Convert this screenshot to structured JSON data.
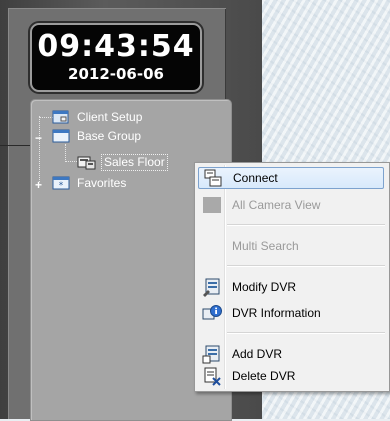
{
  "clock": {
    "time": "09:43:54",
    "date": "2012-06-06"
  },
  "tree": {
    "items": [
      {
        "label": "Client Setup",
        "icon": "client-setup-icon"
      },
      {
        "label": "Base Group",
        "icon": "group-icon",
        "expander": "−"
      },
      {
        "label": "Sales Floor",
        "icon": "dvr-icon",
        "selected": true
      },
      {
        "label": "Favorites",
        "icon": "favorites-icon",
        "expander": "+"
      }
    ]
  },
  "context_menu": {
    "items": [
      {
        "label": "Connect",
        "icon": "connect-icon",
        "state": "hover"
      },
      {
        "label": "All Camera View",
        "icon": "camera-view-icon",
        "state": "disabled"
      },
      {
        "label": "Multi Search",
        "icon": "none",
        "state": "disabled"
      },
      {
        "label": "Modify DVR",
        "icon": "modify-dvr-icon",
        "state": "enabled"
      },
      {
        "label": "DVR Information",
        "icon": "dvr-information-icon",
        "state": "enabled"
      },
      {
        "label": "Add DVR",
        "icon": "add-dvr-icon",
        "state": "enabled"
      },
      {
        "label": "Delete DVR",
        "icon": "delete-dvr-icon",
        "state": "enabled"
      }
    ]
  },
  "colors": {
    "panel": "#707070",
    "tree_bg": "#a5a5a5",
    "menu_bg": "#f1f1f1",
    "hover_border": "#7da2ce",
    "disabled_text": "#9a9a9a"
  }
}
